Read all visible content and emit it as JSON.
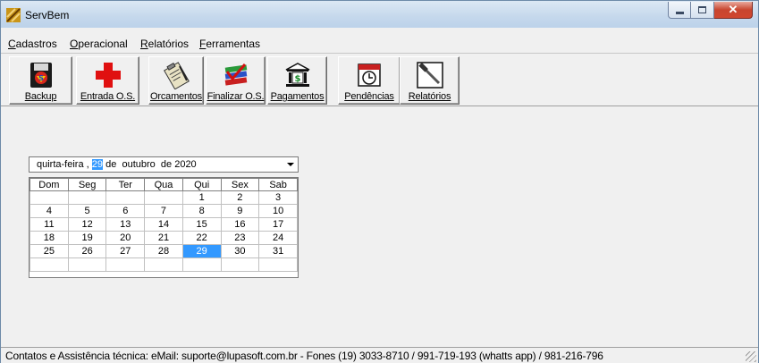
{
  "window": {
    "title": "ServBem"
  },
  "menu": [
    {
      "label": "Cadastros",
      "mnemonic": "C",
      "rest": "adastros"
    },
    {
      "label": "Operacional",
      "mnemonic": "O",
      "rest": "peracional"
    },
    {
      "label": "Relatórios",
      "mnemonic": "R",
      "rest": "elatórios"
    },
    {
      "label": "Ferramentas",
      "mnemonic": "F",
      "rest": "erramentas"
    }
  ],
  "toolbar": [
    {
      "label": "Backup",
      "icon": "backup-icon"
    },
    {
      "label": "Entrada O.S.",
      "icon": "red-cross-icon"
    },
    {
      "label": "Orcamentos",
      "icon": "clipboard-icon"
    },
    {
      "label": "Finalizar O.S.",
      "icon": "books-icon"
    },
    {
      "label": "Pagamentos",
      "icon": "bank-icon"
    },
    {
      "label": "Pendências",
      "icon": "calendar-clock-icon"
    },
    {
      "label": "Relatórios",
      "icon": "hammer-icon"
    }
  ],
  "date_picker": {
    "weekday": "quirta-feira",
    "separator": ",",
    "day": "29",
    "de1": "de",
    "month": "outubro",
    "de2": "de",
    "year": "2020"
  },
  "calendar": {
    "headers": [
      "Dom",
      "Seg",
      "Ter",
      "Qua",
      "Qui",
      "Sex",
      "Sab"
    ],
    "rows": [
      [
        "",
        "",
        "",
        "",
        "1",
        "2",
        "3"
      ],
      [
        "4",
        "5",
        "6",
        "7",
        "8",
        "9",
        "10"
      ],
      [
        "11",
        "12",
        "13",
        "14",
        "15",
        "16",
        "17"
      ],
      [
        "18",
        "19",
        "20",
        "21",
        "22",
        "23",
        "24"
      ],
      [
        "25",
        "26",
        "27",
        "28",
        "29",
        "30",
        "31"
      ],
      [
        "",
        "",
        "",
        "",
        "",
        "",
        ""
      ]
    ],
    "selected": "29",
    "selected_color": "#3399ff"
  },
  "status": {
    "text": "Contatos e Assistência técnica: eMail: suporte@lupasoft.com.br - Fones (19) 3033-8710 / 991-719-193 (whatts app) / 981-216-796"
  }
}
